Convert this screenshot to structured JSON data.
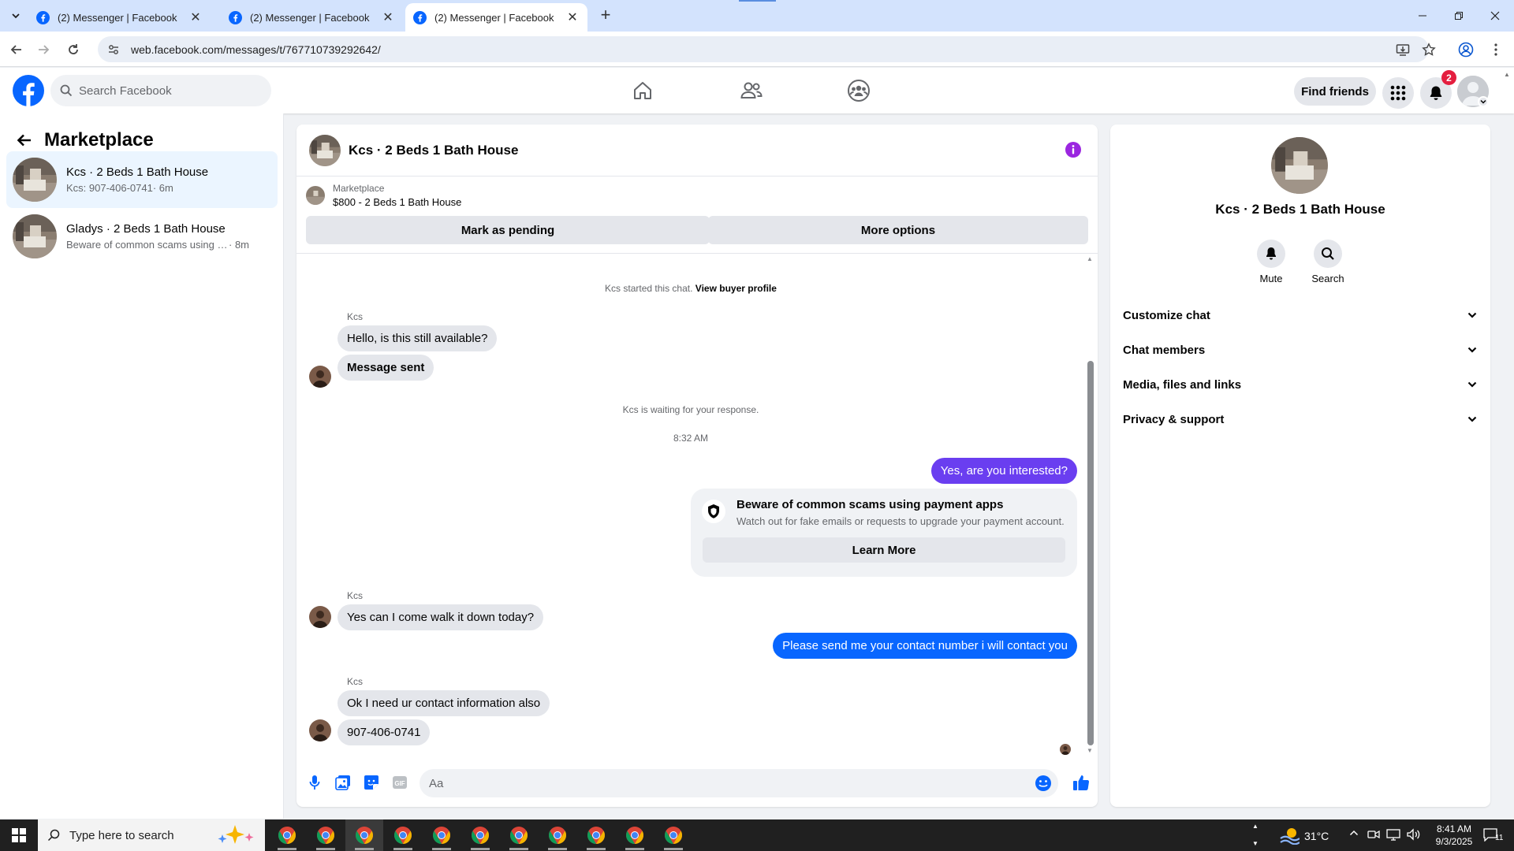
{
  "browser": {
    "tabs": [
      {
        "title": "(2) Messenger | Facebook",
        "active": false
      },
      {
        "title": "(2) Messenger | Facebook",
        "active": false
      },
      {
        "title": "(2) Messenger | Facebook",
        "active": true
      }
    ],
    "url": "web.facebook.com/messages/t/767710739292642/"
  },
  "header": {
    "search_placeholder": "Search Facebook",
    "find_friends": "Find friends",
    "notification_count": "2",
    "brand_color": "#0866ff"
  },
  "left": {
    "title": "Marketplace",
    "conversations": [
      {
        "name": "Kcs · 2 Beds 1 Bath House",
        "preview": "Kcs: 907-406-0741",
        "time": " · 6m",
        "selected": true
      },
      {
        "name": "Gladys · 2 Beds 1 Bath House",
        "preview": "Beware of common scams using pay...",
        "time": " · 8m",
        "selected": false
      }
    ]
  },
  "chat": {
    "title": "Kcs · 2 Beds 1 Bath House",
    "listing_label": "Marketplace",
    "listing_desc": "$800 - 2 Beds 1 Bath House",
    "mark_pending": "Mark as pending",
    "more_options": "More options",
    "started_text": "Kcs started this chat.",
    "view_profile": "View buyer profile",
    "sender": "Kcs",
    "messages": {
      "m1": "Hello, is this still available?",
      "m2": "Message sent",
      "waiting": "Kcs is waiting for your response.",
      "time": "8:32 AM",
      "m3": "Yes, are you interested?",
      "m4": "Yes can I come walk it down today?",
      "m5": "Please send me your contact number i will contact you",
      "m6": "Ok I need ur contact information also",
      "m7": "907-406-0741"
    },
    "scam": {
      "title": "Beware of common scams using payment apps",
      "body": "Watch out for fake emails or requests to upgrade your payment account.",
      "button": "Learn More"
    },
    "composer_placeholder": "Aa",
    "outgoing_color": "#6a3ef0",
    "outgoing_blue": "#0866ff"
  },
  "details": {
    "title": "Kcs · 2 Beds 1 Bath House",
    "mute": "Mute",
    "search": "Search",
    "sections": [
      "Customize chat",
      "Chat members",
      "Media, files and links",
      "Privacy & support"
    ]
  },
  "taskbar": {
    "search_placeholder": "Type here to search",
    "temperature": "31°C",
    "time": "8:41 AM",
    "date": "9/3/2025",
    "notif_count": "11"
  }
}
